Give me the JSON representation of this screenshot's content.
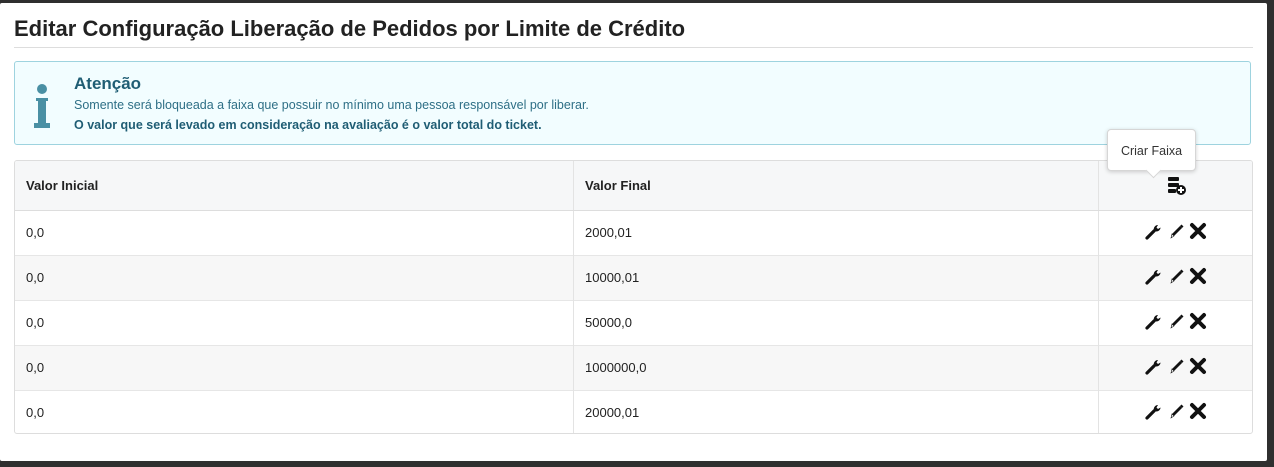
{
  "title": "Editar Configuração Liberação de Pedidos por Limite de Crédito",
  "alert": {
    "icon": "info-icon",
    "heading": "Atenção",
    "line1": "Somente será bloqueada a faixa que possuir no mínimo uma pessoa responsável por liberar.",
    "line2": "O valor que será levado em consideração na avaliação é o valor total do ticket."
  },
  "table": {
    "headers": {
      "initial": "Valor Inicial",
      "final": "Valor Final",
      "create_icon": "create-range-icon"
    },
    "tooltip": "Criar Faixa",
    "rows": [
      {
        "initial": "0,0",
        "final": "2000,01"
      },
      {
        "initial": "0,0",
        "final": "10000,01"
      },
      {
        "initial": "0,0",
        "final": "50000,0"
      },
      {
        "initial": "0,0",
        "final": "1000000,0"
      },
      {
        "initial": "0,0",
        "final": "20000,01"
      }
    ],
    "row_actions": [
      "wrench-icon",
      "pencil-icon",
      "delete-x-icon"
    ]
  },
  "colors": {
    "alert_border": "#9ed3df",
    "alert_background": "#f2fdff",
    "alert_text": "#1f5d74",
    "icon_color": "#111111"
  }
}
